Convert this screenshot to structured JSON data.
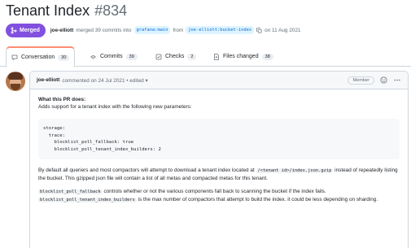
{
  "header": {
    "title": "Tenant Index",
    "number": "#834"
  },
  "state": {
    "badge": "Merged",
    "author": "joe-elliott",
    "text_merged": "merged 39 commits into",
    "base_branch": "grafana:main",
    "text_from": "from",
    "head_branch": "joe-elliott:bucket-index",
    "date": "on 11 Aug 2021"
  },
  "tabs": [
    {
      "label": "Conversation",
      "count": "30"
    },
    {
      "label": "Commits",
      "count": "39"
    },
    {
      "label": "Checks",
      "count": "2"
    },
    {
      "label": "Files changed",
      "count": "38"
    }
  ],
  "comment": {
    "author": "joe-elliott",
    "meta": "commented on 24 Jul 2021 • edited ▾",
    "role": "Member",
    "heading": "What this PR does:",
    "intro": "Adds support for a tenant index with the following new parameters:",
    "code": "storage:\n  trace:\n    blocklist_poll_fallback: true\n    blocklist_poll_tenant_index_builders: 2",
    "p1_before": "By default all queriers and most compactors will attempt to download a tenant index located at",
    "p1_code": "/<tenant id>/index.json.gzip",
    "p1_after": "instead of repeatedly listing the bucket. This gzipped json file will contain a list of all metas and compacted metas for this tenant.",
    "p2_code": "blocklist_poll_fallback",
    "p2_after": "controls whether or not the various components fall back to scanning the bucket if the index fails.",
    "p3_code": "blocklist_poll_tenant_index_builders",
    "p3_after": "is the max number of compactors that attempt to build the index. it could be less depending on sharding."
  }
}
